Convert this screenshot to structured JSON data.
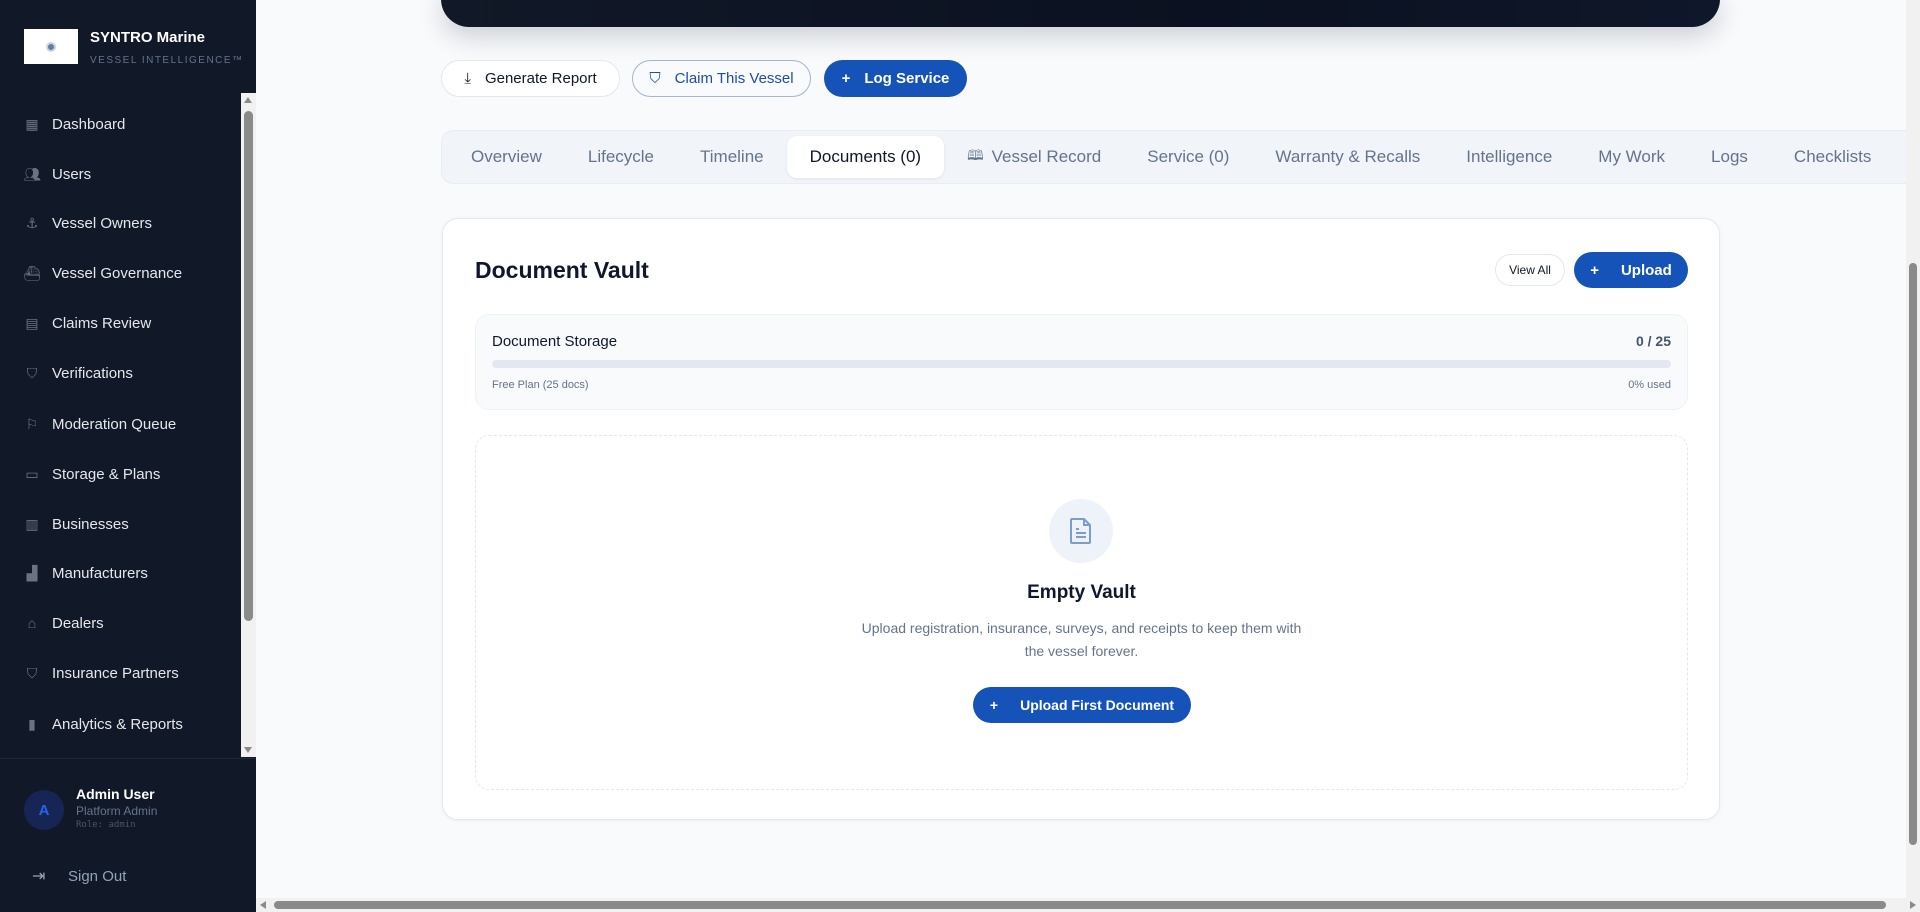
{
  "sidebar": {
    "brand": "SYNTRO Marine",
    "tagline": "VESSEL INTELLIGENCE™",
    "logo_text": "SYNTRO",
    "items": [
      {
        "label": "Dashboard",
        "icon": "grid-icon"
      },
      {
        "label": "Users",
        "icon": "users-icon"
      },
      {
        "label": "Vessel Owners",
        "icon": "anchor-icon"
      },
      {
        "label": "Vessel Governance",
        "icon": "ship-icon"
      },
      {
        "label": "Claims Review",
        "icon": "file-icon"
      },
      {
        "label": "Verifications",
        "icon": "shield-icon"
      },
      {
        "label": "Moderation Queue",
        "icon": "flag-icon"
      },
      {
        "label": "Storage & Plans",
        "icon": "hard-drive-icon"
      },
      {
        "label": "Businesses",
        "icon": "building-icon"
      },
      {
        "label": "Manufacturers",
        "icon": "factory-icon"
      },
      {
        "label": "Dealers",
        "icon": "store-icon"
      },
      {
        "label": "Insurance Partners",
        "icon": "shield-icon"
      },
      {
        "label": "Analytics & Reports",
        "icon": "bar-chart-icon"
      }
    ],
    "user": {
      "initial": "A",
      "name": "Admin User",
      "title": "Platform Admin",
      "role": "Role: admin"
    },
    "sign_out": "Sign Out"
  },
  "actions": {
    "generate_report": "Generate Report",
    "claim_vessel": "Claim This Vessel",
    "log_service": "Log Service"
  },
  "tabs": [
    {
      "label": "Overview"
    },
    {
      "label": "Lifecycle"
    },
    {
      "label": "Timeline"
    },
    {
      "label": "Documents (0)",
      "active": true
    },
    {
      "label": "Vessel Record"
    },
    {
      "label": "Service (0)"
    },
    {
      "label": "Warranty & Recalls"
    },
    {
      "label": "Intelligence"
    },
    {
      "label": "My Work"
    },
    {
      "label": "Logs"
    },
    {
      "label": "Checklists"
    }
  ],
  "vault": {
    "title": "Document Vault",
    "view_all": "View All",
    "upload": "Upload",
    "storage": {
      "label": "Document Storage",
      "count": "0 / 25",
      "used_fraction": 0,
      "plan": "Free Plan (25 docs)",
      "used_text": "0% used"
    },
    "empty": {
      "title": "Empty Vault",
      "description": "Upload registration, insurance, surveys, and receipts to keep them with the vessel forever.",
      "button": "Upload First Document"
    }
  },
  "colors": {
    "accent": "#1553b8",
    "sidebar_bg": "#111827",
    "page_bg": "#f8fafc"
  }
}
